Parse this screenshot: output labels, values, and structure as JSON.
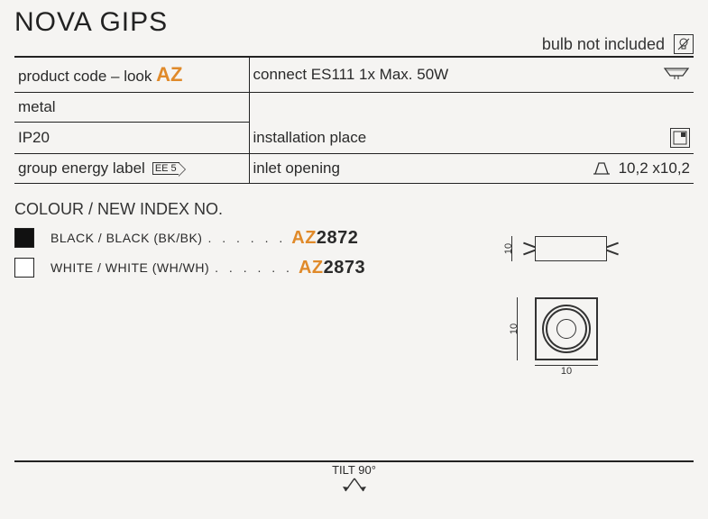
{
  "title": "NOVA GIPS",
  "bulb_note": "bulb not included",
  "spec": {
    "product_code_label": "product code – look",
    "product_code_suffix": "AZ",
    "connect": "connect ES111 1x Max. 50W",
    "material": "metal",
    "ip": "IP20",
    "installation_label": "installation place",
    "group_energy_label": "group energy label",
    "ee_rating": "EE 5",
    "inlet_label": "inlet opening",
    "inlet_value": "10,2 x10,2"
  },
  "colour_header": "COLOUR / NEW INDEX NO.",
  "colours": [
    {
      "swatch": "black",
      "name": "BLACK / BLACK (BK/BK)",
      "prefix": "AZ",
      "code": "2872"
    },
    {
      "swatch": "white",
      "name": "WHITE / WHITE (WH/WH)",
      "prefix": "AZ",
      "code": "2873"
    }
  ],
  "dimensions": {
    "height_side": "10",
    "height_top": "10",
    "width_top": "10"
  },
  "tilt": "TILT 90°"
}
